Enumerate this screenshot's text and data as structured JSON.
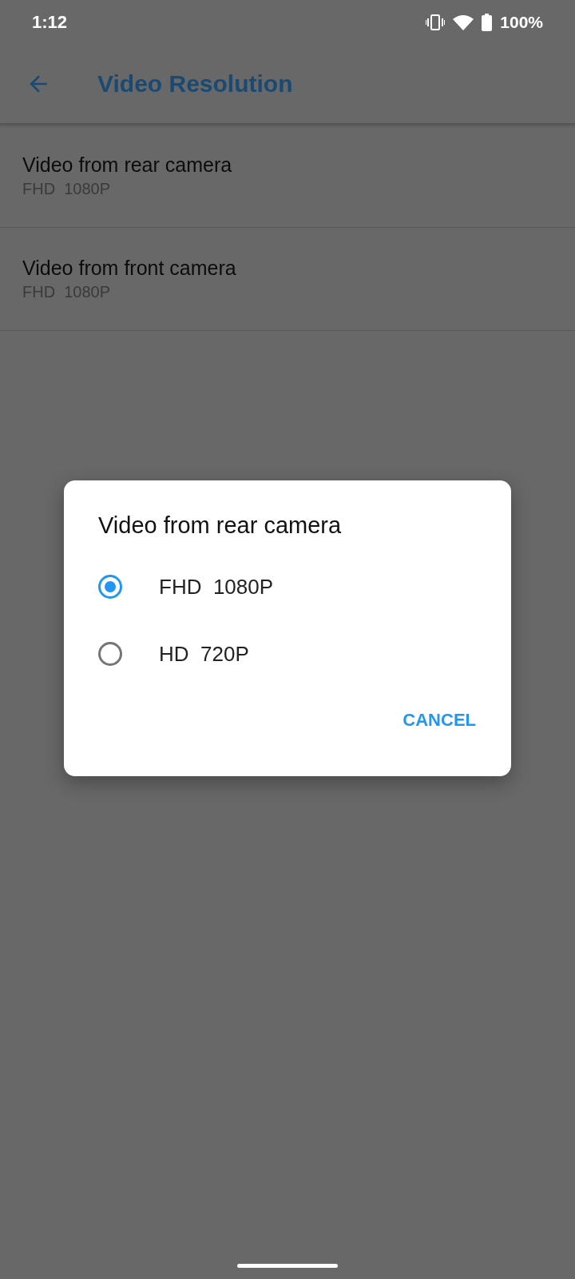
{
  "status_bar": {
    "time": "1:12",
    "battery": "100%"
  },
  "app_bar": {
    "title": "Video Resolution"
  },
  "settings": [
    {
      "title": "Video from rear camera",
      "value": "FHD  1080P"
    },
    {
      "title": "Video from front camera",
      "value": "FHD  1080P"
    }
  ],
  "dialog": {
    "title": "Video from rear camera",
    "options": [
      {
        "label": "FHD  1080P",
        "selected": true
      },
      {
        "label": "HD  720P",
        "selected": false
      }
    ],
    "buttons": [
      "CANCEL"
    ]
  }
}
